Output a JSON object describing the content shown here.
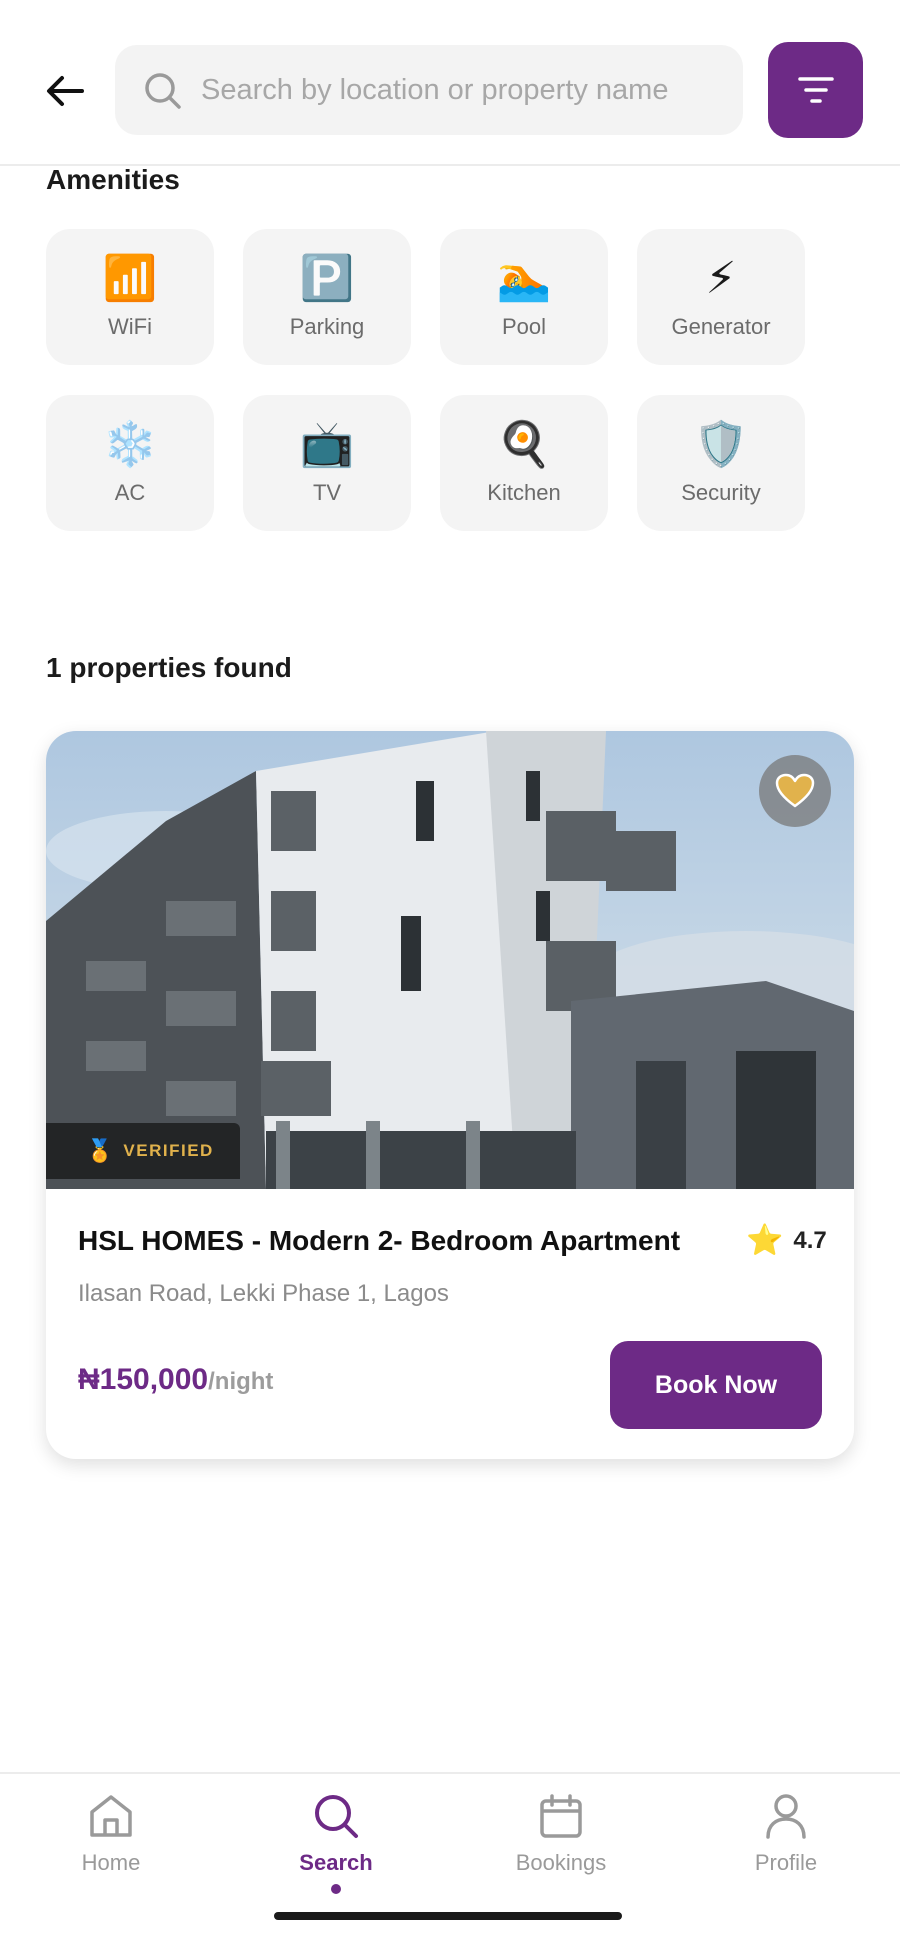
{
  "header": {
    "search_placeholder": "Search by location or property name"
  },
  "amenities": {
    "title": "Amenities",
    "items": [
      {
        "label": "WiFi",
        "icon": "📶",
        "icon_name": "wifi-icon"
      },
      {
        "label": "Parking",
        "icon": "🅿️",
        "icon_name": "parking-icon"
      },
      {
        "label": "Pool",
        "icon": "🏊",
        "icon_name": "pool-icon"
      },
      {
        "label": "Generator",
        "icon": "⚡",
        "icon_name": "generator-icon"
      },
      {
        "label": "AC",
        "icon": "❄️",
        "icon_name": "ac-icon"
      },
      {
        "label": "TV",
        "icon": "📺",
        "icon_name": "tv-icon"
      },
      {
        "label": "Kitchen",
        "icon": "🍳",
        "icon_name": "kitchen-icon"
      },
      {
        "label": "Security",
        "icon": "🛡️",
        "icon_name": "security-icon"
      }
    ]
  },
  "results": {
    "count_text": "1 properties found"
  },
  "property": {
    "badge": "VERIFIED",
    "badge_icon": "🏅",
    "title": "HSL HOMES - Modern 2- Bedroom Apartment",
    "rating": "4.7",
    "star": "⭐",
    "address": "Ilasan Road, Lekki Phase 1, Lagos",
    "price": "₦150,000",
    "price_unit": "/night",
    "book_label": "Book Now"
  },
  "nav": {
    "items": [
      {
        "label": "Home",
        "icon_name": "home-icon",
        "active": false
      },
      {
        "label": "Search",
        "icon_name": "search-icon",
        "active": true
      },
      {
        "label": "Bookings",
        "icon_name": "calendar-icon",
        "active": false
      },
      {
        "label": "Profile",
        "icon_name": "profile-icon",
        "active": false
      }
    ]
  },
  "colors": {
    "brand": "#6d2a86",
    "tile_bg": "#f4f4f4",
    "muted_text": "#8b8b8b",
    "badge_text": "#e1b24c",
    "star": "#f4c21b"
  }
}
